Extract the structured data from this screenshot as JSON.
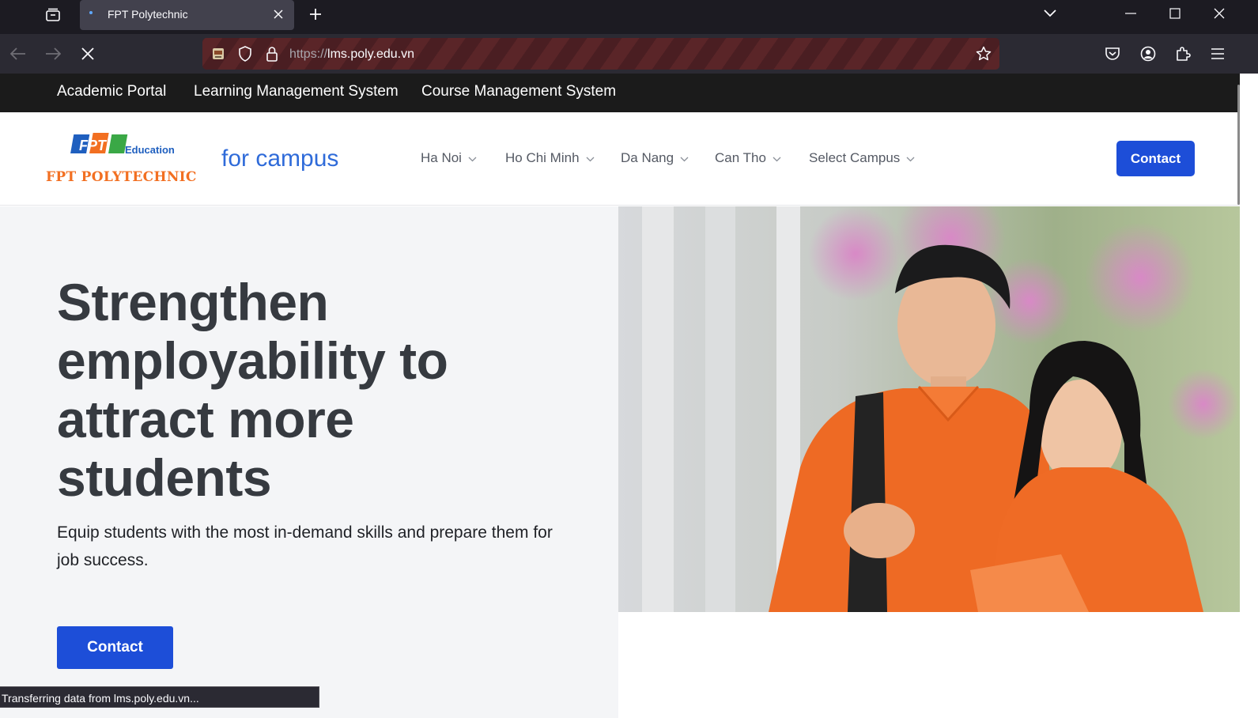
{
  "browser": {
    "tab": {
      "title": "FPT Polytechnic"
    },
    "url": {
      "scheme": "https://",
      "host": "lms.poly.edu.vn"
    },
    "status_text": "Transferring data from lms.poly.edu.vn..."
  },
  "top_links": [
    "Academic Portal",
    "Learning Management System",
    "Course Management System"
  ],
  "header": {
    "logo": {
      "brand": "FPT",
      "edu": "Education",
      "school": "FPT POLYTECHNIC"
    },
    "tagline": "for campus",
    "menu": [
      "Ha Noi",
      "Ho Chi Minh",
      "Da Nang",
      "Can Tho",
      "Select Campus"
    ],
    "contact_label": "Contact"
  },
  "hero": {
    "title_lines": [
      "Strengthen",
      "employability to",
      "attract more",
      "students"
    ],
    "subtitle": "Equip students with the most in-demand skills and prepare them for job success.",
    "cta_label": "Contact"
  },
  "colors": {
    "brand_blue": "#1d4ed8",
    "tagline_blue": "#2f6bd9",
    "fpt_orange": "#f26f21",
    "hero_bg": "#f4f5f7"
  }
}
